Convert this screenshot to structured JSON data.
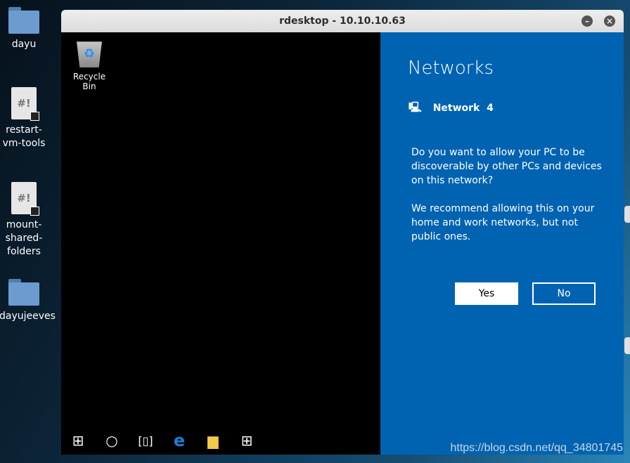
{
  "desktop": {
    "icons": [
      {
        "label": "dayu",
        "type": "folder"
      },
      {
        "label": "restart-vm-tools",
        "type": "script"
      },
      {
        "label": "mount-shared-folders",
        "type": "script"
      },
      {
        "label": "dayujeeves",
        "type": "folder"
      }
    ]
  },
  "window": {
    "title": "rdesktop - 10.10.10.63"
  },
  "remote": {
    "recycle_bin": "Recycle Bin",
    "taskbar": [
      "windows-start-icon",
      "cortana-circle-icon",
      "task-view-icon",
      "edge-icon",
      "file-explorer-icon",
      "store-icon"
    ]
  },
  "networks": {
    "title": "Networks",
    "network_name": "Network  4",
    "question": "Do you want to allow your PC to be discoverable by other PCs and devices on this network?",
    "recommendation": "We recommend allowing this on your home and work networks, but not public ones.",
    "yes": "Yes",
    "no": "No",
    "accent": "#0063b1"
  },
  "watermark": "https://blog.csdn.net/qq_34801745"
}
